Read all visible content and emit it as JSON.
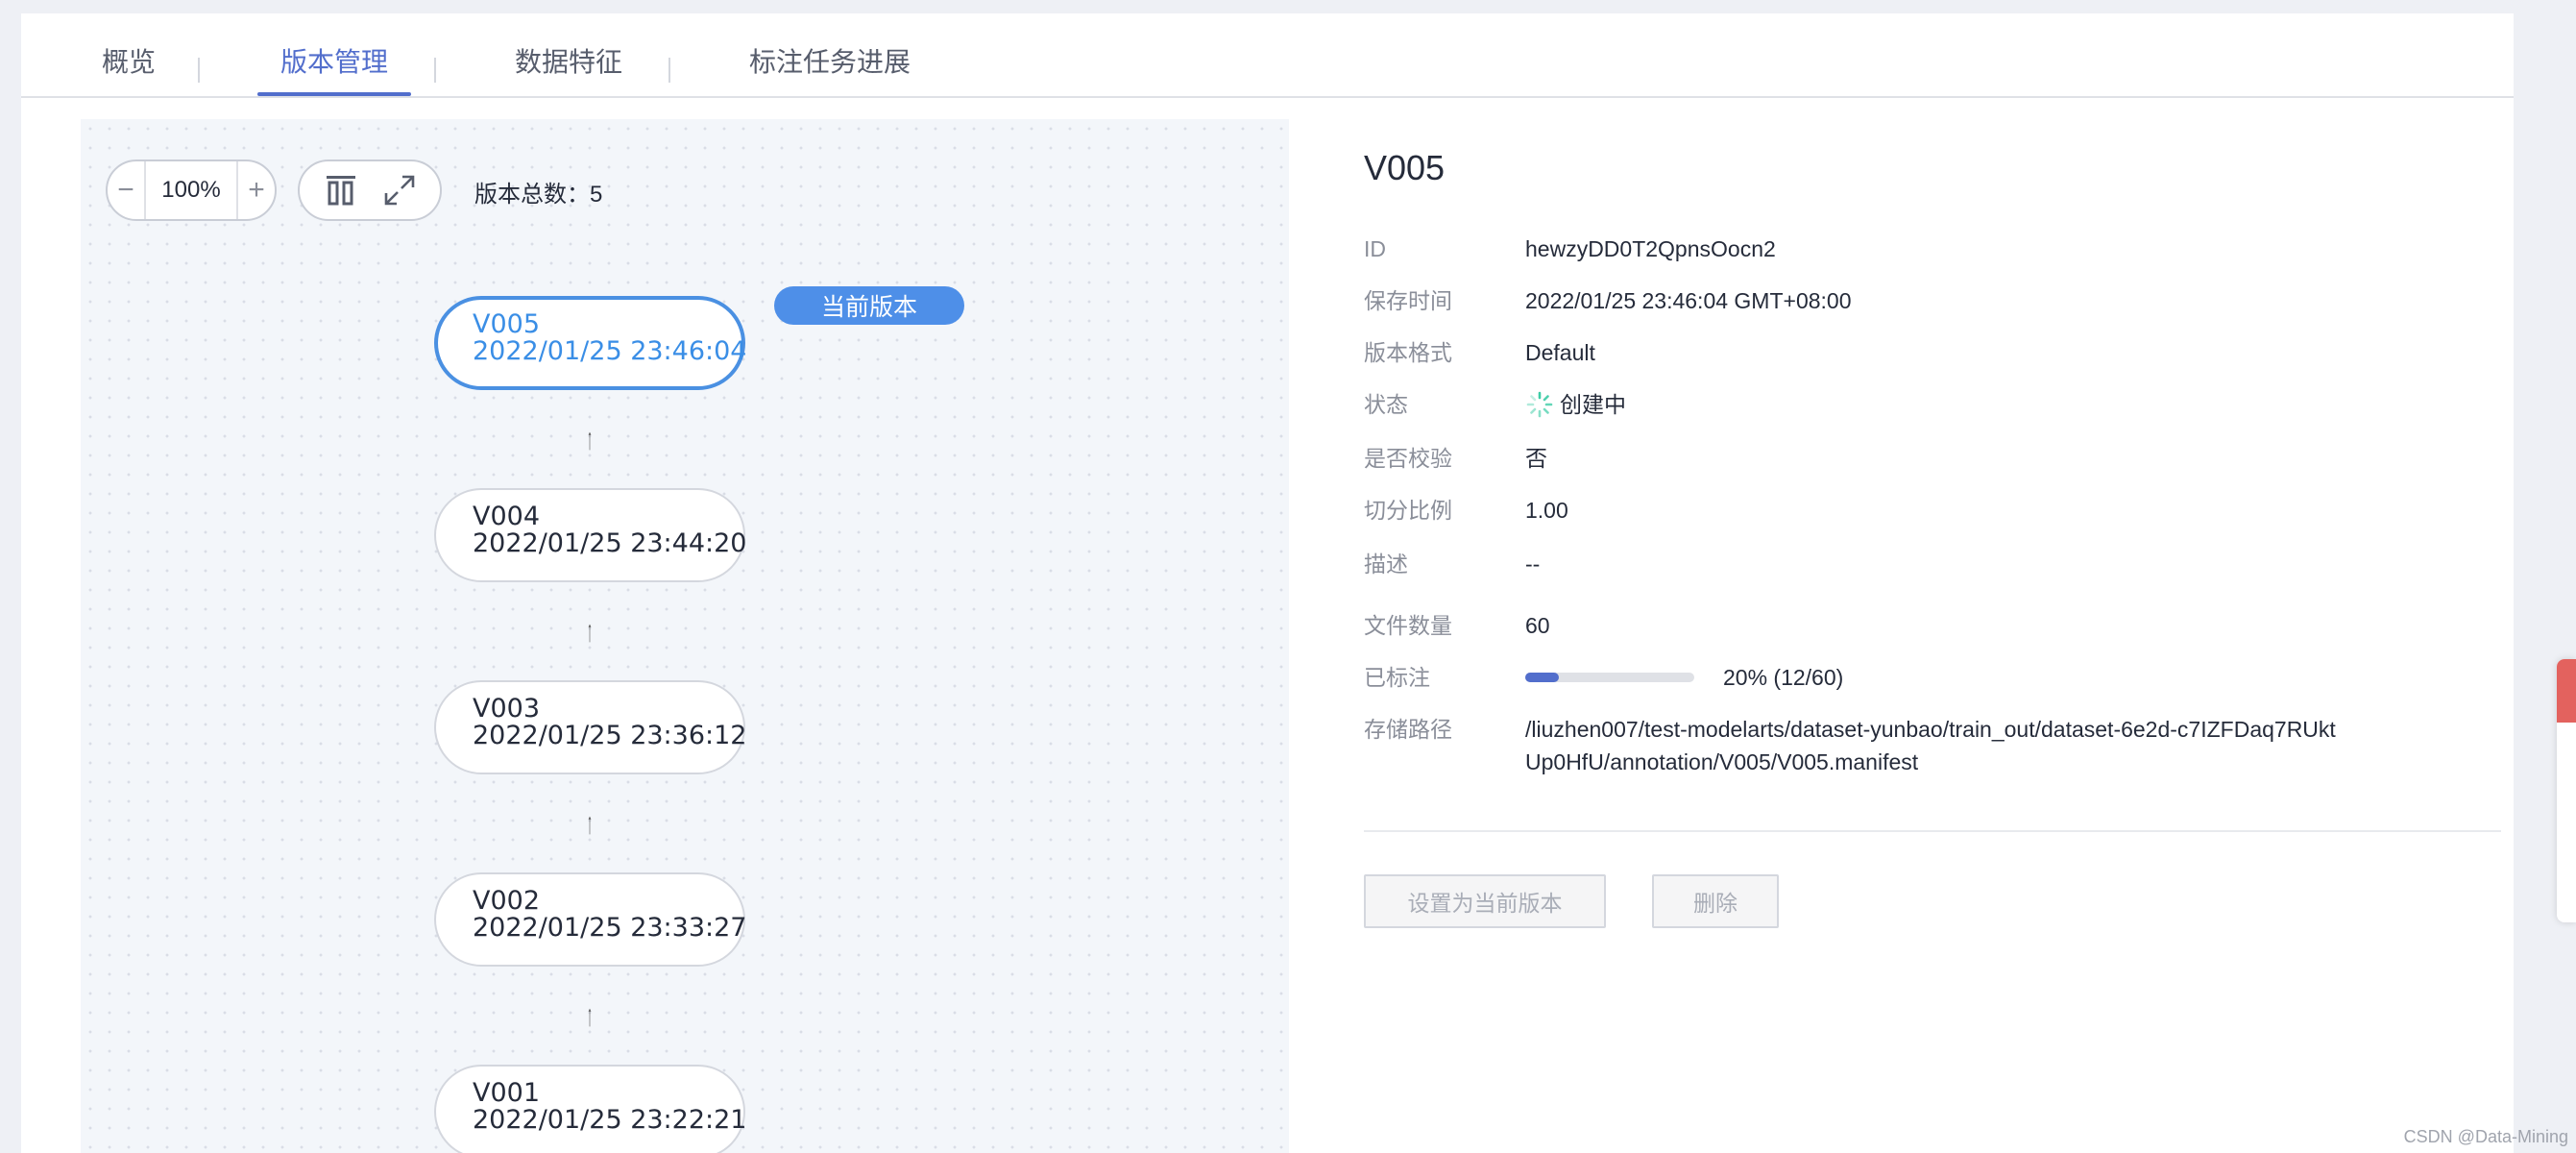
{
  "tabs": [
    {
      "label": "概览",
      "active": false
    },
    {
      "label": "版本管理",
      "active": true
    },
    {
      "label": "数据特征",
      "active": false
    },
    {
      "label": "标注任务进展",
      "active": false
    }
  ],
  "toolbar": {
    "zoom_minus": "−",
    "zoom_value": "100%",
    "zoom_plus": "+",
    "layout_icon": "align-top-icon",
    "fullscreen_icon": "fullscreen-icon",
    "total_label": "版本总数：",
    "total_value": "5"
  },
  "graph": {
    "current_badge": "当前版本",
    "nodes": [
      {
        "version": "V005",
        "time": "2022/01/25 23:46:04",
        "current": true
      },
      {
        "version": "V004",
        "time": "2022/01/25 23:44:20",
        "current": false
      },
      {
        "version": "V003",
        "time": "2022/01/25 23:36:12",
        "current": false
      },
      {
        "version": "V002",
        "time": "2022/01/25 23:33:27",
        "current": false
      },
      {
        "version": "V001",
        "time": "2022/01/25 23:22:21",
        "current": false
      }
    ]
  },
  "details": {
    "title": "V005",
    "id_label": "ID",
    "id_value": "hewzyDD0T2QpnsOocn2",
    "save_time_label": "保存时间",
    "save_time_value": "2022/01/25 23:46:04 GMT+08:00",
    "format_label": "版本格式",
    "format_value": "Default",
    "status_label": "状态",
    "status_value": "创建中",
    "status_icon": "loading-spinner-icon",
    "verify_label": "是否校验",
    "verify_value": "否",
    "split_label": "切分比例",
    "split_value": "1.00",
    "desc_label": "描述",
    "desc_value": "--",
    "file_count_label": "文件数量",
    "file_count_value": "60",
    "annotated_label": "已标注",
    "annotated_percent": 20,
    "annotated_text": "20% (12/60)",
    "path_label": "存储路径",
    "path_line1": "/liuzhen007/test-modelarts/dataset-yunbao/train_out/dataset-6e2d-c7IZFDaq7RUkt",
    "path_line2": "Up0HfU/annotation/V005/V005.manifest",
    "set_current_button": "设置为当前版本",
    "delete_button": "删除"
  },
  "colors": {
    "accent": "#526ecc",
    "current_node": "#4a90e2",
    "badge": "#4e8fe8",
    "spinner": "#3dcca6"
  },
  "watermark": "CSDN @Data-Mining"
}
